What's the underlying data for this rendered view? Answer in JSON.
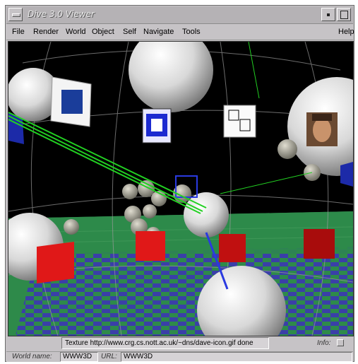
{
  "window": {
    "title": "Dive 3.0 Viewer"
  },
  "menubar": {
    "items": [
      "File",
      "Render",
      "World",
      "Object",
      "Self",
      "Navigate",
      "Tools"
    ],
    "help": "Help"
  },
  "status": {
    "message": "Texture http://www.crg.cs.nott.ac.uk/~dns/dave-icon.gif done",
    "info_label": "Info:"
  },
  "world": {
    "name_label": "World name:",
    "name_value": "WWW3D",
    "url_label": "URL:",
    "url_value": "WWW3D"
  },
  "colors": {
    "window_bg": "#c6c3c6",
    "viewport_bg": "#000000",
    "floor_green": "#2e8a4a",
    "floor_blue": "#3a3fa8",
    "cube_red": "#e01818",
    "label_yellow": "#e8e020",
    "link_green": "#22d022"
  }
}
